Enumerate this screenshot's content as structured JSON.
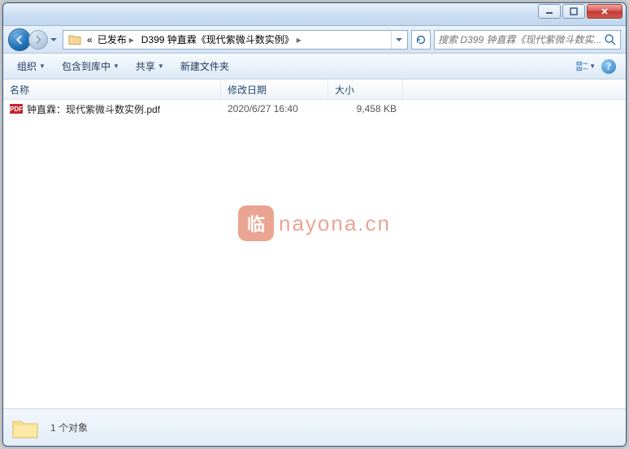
{
  "breadcrumb": {
    "prefix": "«",
    "parent": "已发布",
    "current": "D399 钟直霖《现代紫微斗数实例》"
  },
  "search": {
    "placeholder": "搜索 D399 钟直霖《现代紫微斗数实..."
  },
  "toolbar": {
    "organize": "组织",
    "include": "包含到库中",
    "share": "共享",
    "newfolder": "新建文件夹"
  },
  "columns": {
    "name": "名称",
    "date": "修改日期",
    "size": "大小"
  },
  "files": [
    {
      "icon": "PDF",
      "name": "钟直霖：现代紫微斗数实例.pdf",
      "date": "2020/6/27 16:40",
      "size": "9,458 KB"
    }
  ],
  "status": {
    "text": "1 个对象"
  },
  "watermark": {
    "badge": "临",
    "text": "nayona.cn"
  }
}
